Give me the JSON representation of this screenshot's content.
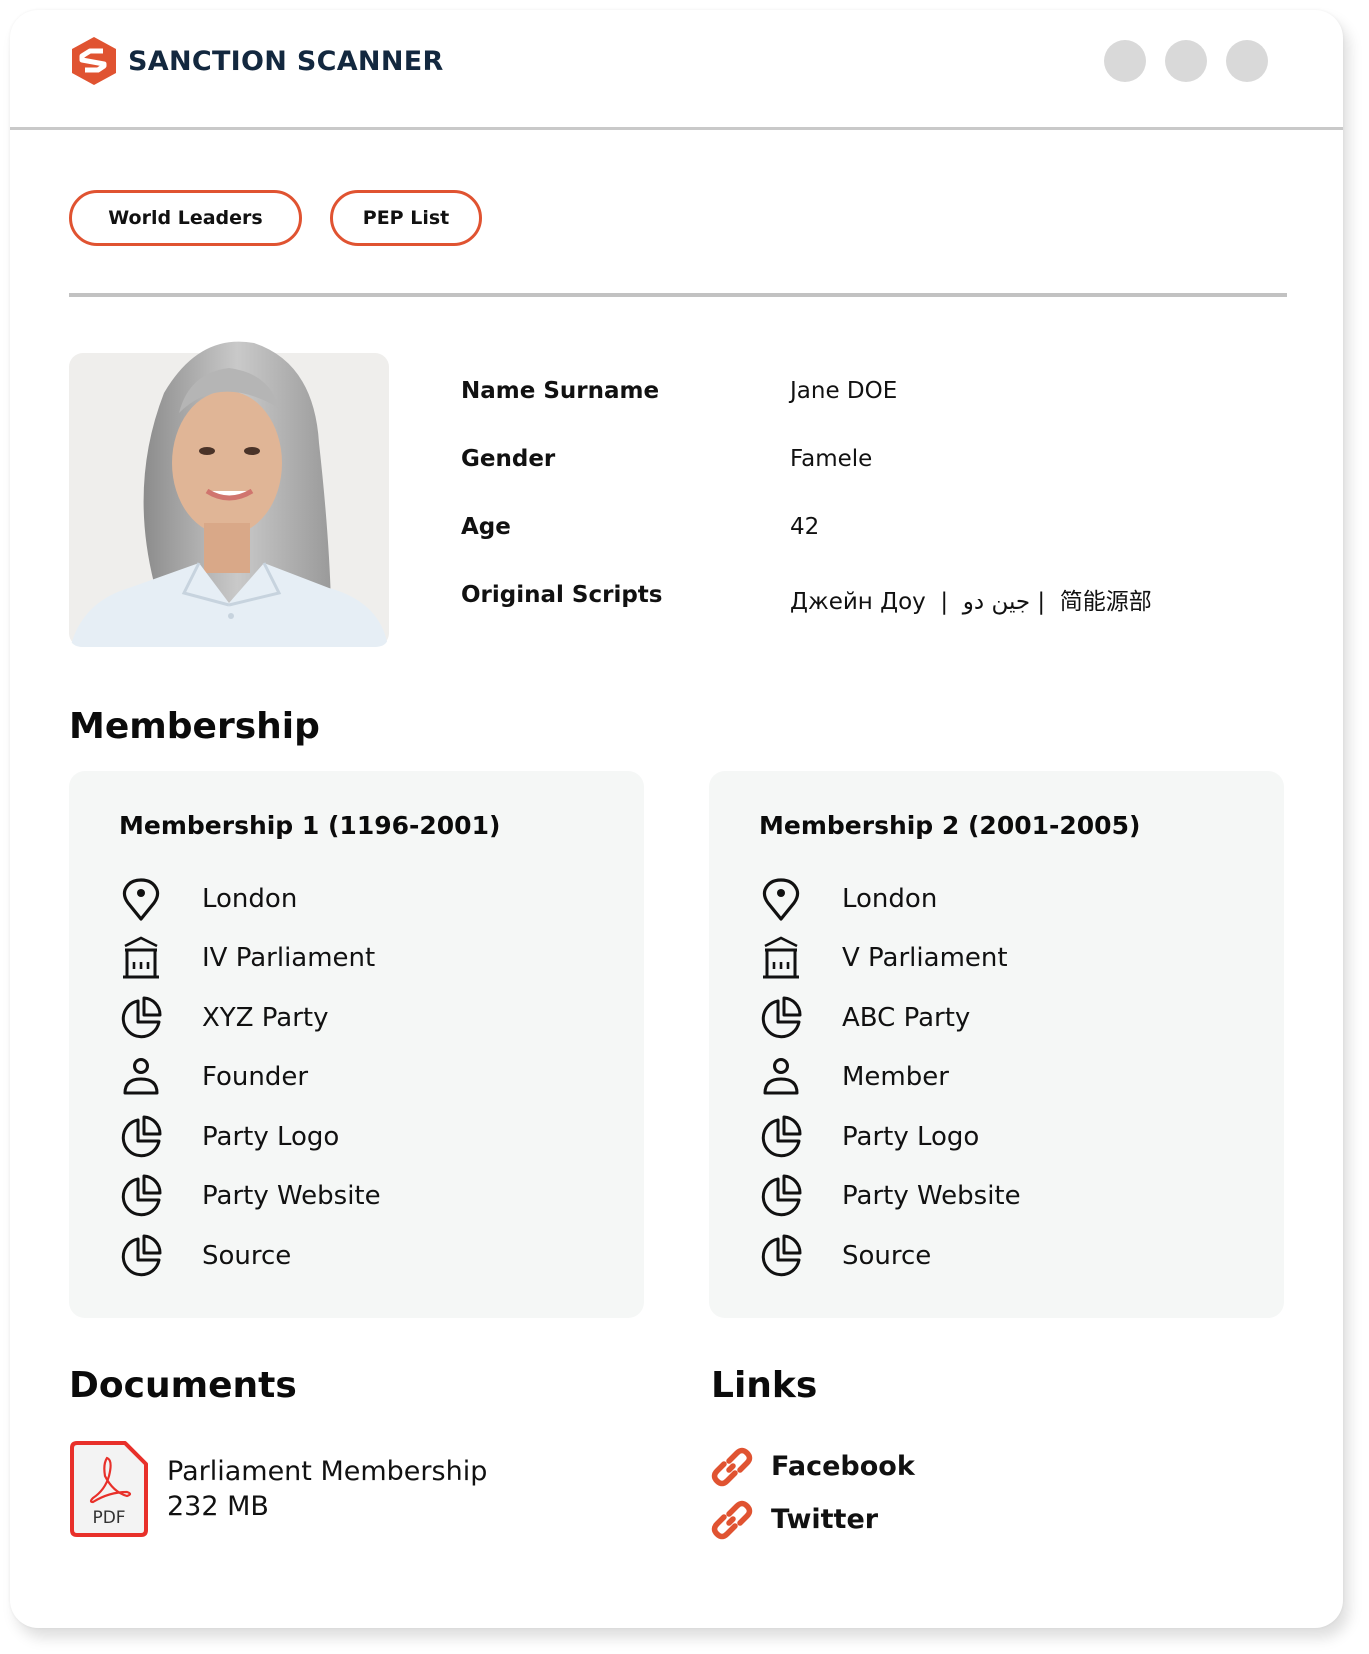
{
  "app": {
    "brand_name": "SANCTION SCANNER",
    "brand_color": "#e05331",
    "brand_text_color": "#13283f",
    "window_controls": [
      "window-dot",
      "window-dot",
      "window-dot"
    ]
  },
  "tags": [
    {
      "label": "World Leaders"
    },
    {
      "label": "PEP List"
    }
  ],
  "profile": {
    "photo_alt": "Portrait of Jane DOE",
    "fields": [
      {
        "label": "Name Surname",
        "value": "Jane DOE"
      },
      {
        "label": "Gender",
        "value": "Famele"
      },
      {
        "label": "Age",
        "value": "42"
      },
      {
        "label": "Original Scripts",
        "value": "Джейн Доу  |  جين دو |  简能源部"
      }
    ]
  },
  "membership": {
    "heading": "Membership",
    "cards": [
      {
        "title": "Membership 1 (1196-2001)",
        "items": [
          {
            "icon": "location-pin-icon",
            "label": "London"
          },
          {
            "icon": "parliament-building-icon",
            "label": "IV Parliament"
          },
          {
            "icon": "pie-chart-icon",
            "label": "XYZ Party"
          },
          {
            "icon": "user-icon",
            "label": "Founder"
          },
          {
            "icon": "pie-chart-icon",
            "label": "Party Logo"
          },
          {
            "icon": "pie-chart-icon",
            "label": "Party Website"
          },
          {
            "icon": "pie-chart-icon",
            "label": "Source"
          }
        ]
      },
      {
        "title": "Membership 2 (2001-2005)",
        "items": [
          {
            "icon": "location-pin-icon",
            "label": "London"
          },
          {
            "icon": "parliament-building-icon",
            "label": "V Parliament"
          },
          {
            "icon": "pie-chart-icon",
            "label": "ABC Party"
          },
          {
            "icon": "user-icon",
            "label": "Member"
          },
          {
            "icon": "pie-chart-icon",
            "label": "Party Logo"
          },
          {
            "icon": "pie-chart-icon",
            "label": "Party Website"
          },
          {
            "icon": "pie-chart-icon",
            "label": "Source"
          }
        ]
      }
    ]
  },
  "documents": {
    "heading": "Documents",
    "items": [
      {
        "icon": "pdf-file-icon",
        "type_label": "PDF",
        "name": "Parliament Membership",
        "size": "232 MB"
      }
    ]
  },
  "links": {
    "heading": "Links",
    "items": [
      {
        "icon": "link-icon",
        "label": "Facebook"
      },
      {
        "icon": "link-icon",
        "label": "Twitter"
      }
    ]
  }
}
